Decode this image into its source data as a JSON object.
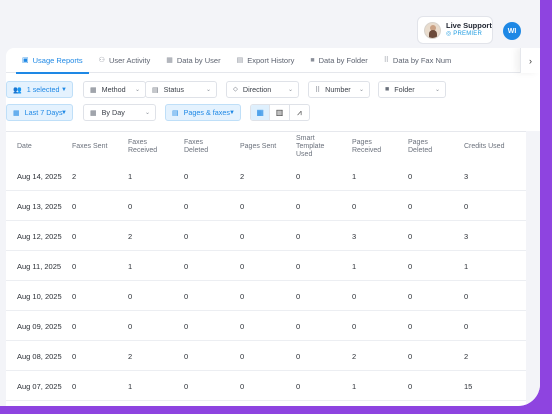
{
  "header": {
    "live_support_title": "Live Support",
    "live_support_sub": "◎ PREMIER",
    "user_initials": "WI"
  },
  "tabs": [
    {
      "label": "Usage Reports",
      "icon": "usage-report-icon",
      "active": true
    },
    {
      "label": "User Activity",
      "icon": "user-activity-icon",
      "active": false
    },
    {
      "label": "Data by User",
      "icon": "data-user-icon",
      "active": false
    },
    {
      "label": "Export History",
      "icon": "export-history-icon",
      "active": false
    },
    {
      "label": "Data by Folder",
      "icon": "folder-icon",
      "active": false
    },
    {
      "label": "Data by Fax Num",
      "icon": "fax-number-icon",
      "active": false
    }
  ],
  "filters": {
    "users": "1 selected",
    "method": "Method",
    "status": "Status",
    "direction": "Direction",
    "number": "Number",
    "folder": "Folder",
    "period": "Last 7 Days",
    "granularity": "By Day",
    "metric": "Pages & faxes"
  },
  "table": {
    "columns": [
      "Date",
      "Faxes Sent",
      "Faxes Received",
      "Faxes Deleted",
      "Pages Sent",
      "Smart Template Used",
      "Pages Received",
      "Pages Deleted",
      "Credits Used"
    ],
    "rows": [
      [
        "Aug 14, 2025",
        "2",
        "1",
        "0",
        "2",
        "0",
        "1",
        "0",
        "3"
      ],
      [
        "Aug 13, 2025",
        "0",
        "0",
        "0",
        "0",
        "0",
        "0",
        "0",
        "0"
      ],
      [
        "Aug 12, 2025",
        "0",
        "2",
        "0",
        "0",
        "0",
        "3",
        "0",
        "3"
      ],
      [
        "Aug 11, 2025",
        "0",
        "1",
        "0",
        "0",
        "0",
        "1",
        "0",
        "1"
      ],
      [
        "Aug 10, 2025",
        "0",
        "0",
        "0",
        "0",
        "0",
        "0",
        "0",
        "0"
      ],
      [
        "Aug 09, 2025",
        "0",
        "0",
        "0",
        "0",
        "0",
        "0",
        "0",
        "0"
      ],
      [
        "Aug 08, 2025",
        "0",
        "2",
        "0",
        "0",
        "0",
        "2",
        "0",
        "2"
      ],
      [
        "Aug 07, 2025",
        "0",
        "1",
        "0",
        "0",
        "0",
        "1",
        "0",
        "15"
      ]
    ]
  },
  "colors": {
    "accent": "#1e88e5",
    "frame": "#8e44e0"
  }
}
